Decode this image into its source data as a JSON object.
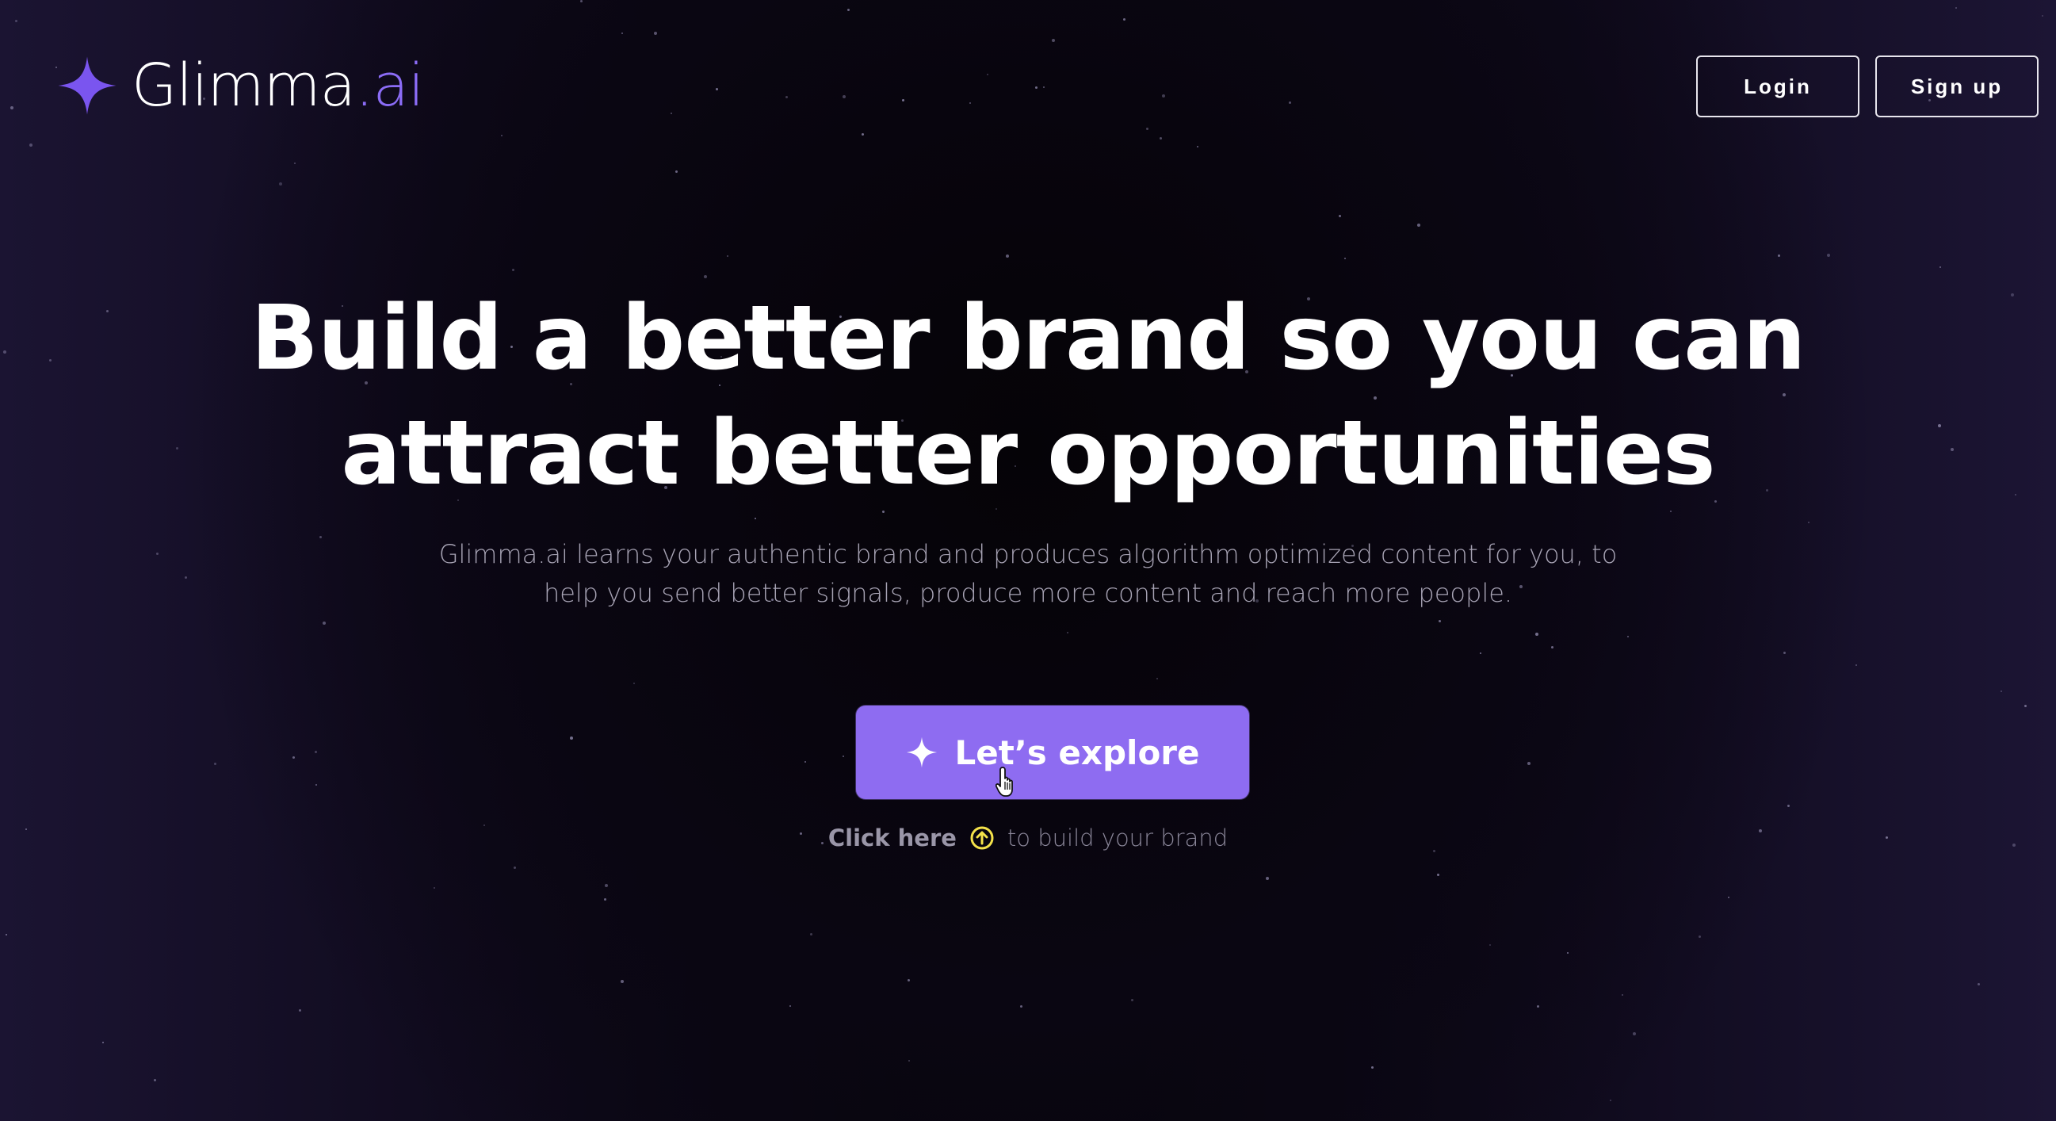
{
  "brand": {
    "name": "Glimma",
    "ext": ".ai",
    "accent_color": "#8b6cf6",
    "icon": "sparkle-star-icon"
  },
  "nav": {
    "login_label": "Login",
    "signup_label": "Sign up"
  },
  "hero": {
    "headline_line1": "Build a better brand so you can",
    "headline_line2": "attract better opportunities",
    "subtext_line1": "Glimma.ai learns your authentic brand and produces algorithm optimized content for you, to",
    "subtext_line2": "help you send better signals, produce more content and reach more people.",
    "cta_label": "Let’s explore",
    "cta_color": "#8e6cf1",
    "cta_icon": "sparkle-icon",
    "hint_strong": "Click here",
    "hint_icon": "arrow-up-circle-icon",
    "hint_icon_color": "#f4e24a",
    "hint_rest": "to build your brand"
  },
  "colors": {
    "background": "#06040b",
    "text": "#ffffff",
    "muted_text": "#a7a3b4"
  }
}
